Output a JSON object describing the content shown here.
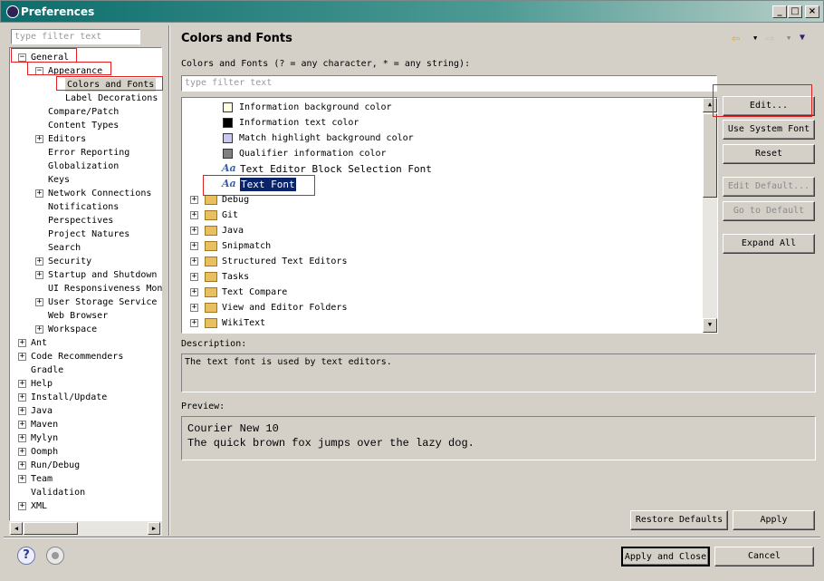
{
  "window": {
    "title": "Preferences"
  },
  "sidebar": {
    "filter_placeholder": "type filter text",
    "items": [
      "General",
      "Appearance",
      "Colors and Fonts",
      "Label Decorations",
      "Compare/Patch",
      "Content Types",
      "Editors",
      "Error Reporting",
      "Globalization",
      "Keys",
      "Network Connections",
      "Notifications",
      "Perspectives",
      "Project Natures",
      "Search",
      "Security",
      "Startup and Shutdown",
      "UI Responsiveness Mon",
      "User Storage Service",
      "Web Browser",
      "Workspace",
      "Ant",
      "Code Recommenders",
      "Gradle",
      "Help",
      "Install/Update",
      "Java",
      "Maven",
      "Mylyn",
      "Oomph",
      "Run/Debug",
      "Team",
      "Validation",
      "XML"
    ]
  },
  "main": {
    "title": "Colors and Fonts",
    "filter_label": "Colors and Fonts (? = any character, * = any string):",
    "filter_placeholder": "type filter text",
    "tree": [
      {
        "label": "Information background color",
        "swatch": "#ffffe1"
      },
      {
        "label": "Information text color",
        "swatch": "#000000"
      },
      {
        "label": "Match highlight background color",
        "swatch": "#c8c8f0"
      },
      {
        "label": "Qualifier information color",
        "swatch": "#808080"
      },
      {
        "label": "Text Editor Block Selection Font",
        "icon": "font-icon"
      },
      {
        "label": "Text Font",
        "icon": "font-icon",
        "selected": true
      },
      {
        "label": "Debug"
      },
      {
        "label": "Git"
      },
      {
        "label": "Java"
      },
      {
        "label": "Snipmatch"
      },
      {
        "label": "Structured Text Editors"
      },
      {
        "label": "Tasks"
      },
      {
        "label": "Text Compare"
      },
      {
        "label": "View and Editor Folders"
      },
      {
        "label": "WikiText"
      }
    ],
    "buttons": {
      "edit": "Edit...",
      "use_system_font": "Use System Font",
      "reset": "Reset",
      "edit_default": "Edit Default...",
      "go_to_default": "Go to Default",
      "expand_all": "Expand All"
    },
    "description_label": "Description:",
    "description": "The text font is used by text editors.",
    "preview_label": "Preview:",
    "preview_line1": "Courier New 10",
    "preview_line2": "The quick brown fox jumps over the lazy dog.",
    "restore_defaults": "Restore Defaults",
    "apply": "Apply"
  },
  "footer": {
    "apply_and_close": "Apply and Close",
    "cancel": "Cancel"
  },
  "colors": {
    "selection": "#0a246a",
    "highlight_box": "#e02020"
  }
}
